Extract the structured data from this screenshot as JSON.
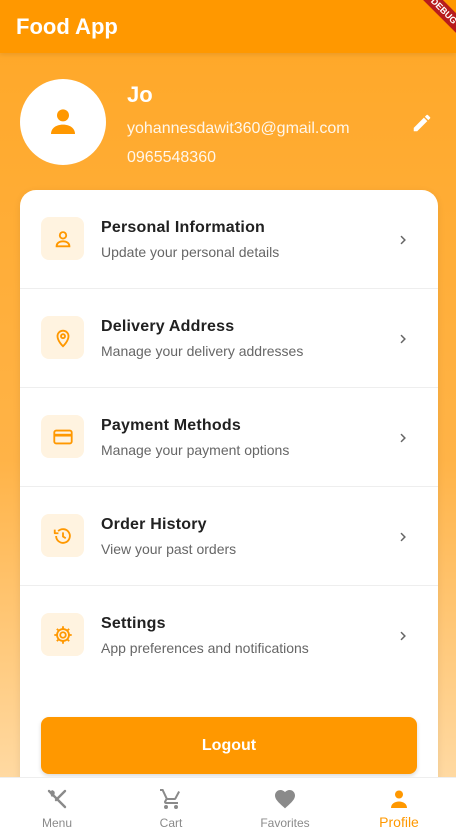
{
  "appbar": {
    "title": "Food App",
    "debug_banner": "DEBUG"
  },
  "profile": {
    "name": "Jo",
    "email": "yohannesdawit360@gmail.com",
    "phone": "0965548360",
    "avatar_icon": "person-icon",
    "edit_icon": "edit-icon"
  },
  "menu": {
    "items": [
      {
        "title": "Personal Information",
        "subtitle": "Update your personal details",
        "icon": "person-outline-icon"
      },
      {
        "title": "Delivery Address",
        "subtitle": "Manage your delivery addresses",
        "icon": "location-pin-icon"
      },
      {
        "title": "Payment Methods",
        "subtitle": "Manage your payment options",
        "icon": "credit-card-icon"
      },
      {
        "title": "Order History",
        "subtitle": "View your past orders",
        "icon": "history-icon"
      },
      {
        "title": "Settings",
        "subtitle": "App preferences and notifications",
        "icon": "gear-icon"
      }
    ],
    "logout_label": "Logout"
  },
  "bottom_nav": {
    "items": [
      {
        "label": "Menu",
        "icon": "fork-knife-icon"
      },
      {
        "label": "Cart",
        "icon": "cart-icon"
      },
      {
        "label": "Favorites",
        "icon": "heart-icon"
      },
      {
        "label": "Profile",
        "icon": "person-icon"
      }
    ],
    "active_index": 3
  },
  "colors": {
    "accent": "#ff9800",
    "accent_light": "#fff3e0",
    "inactive": "#8a8a8a"
  }
}
